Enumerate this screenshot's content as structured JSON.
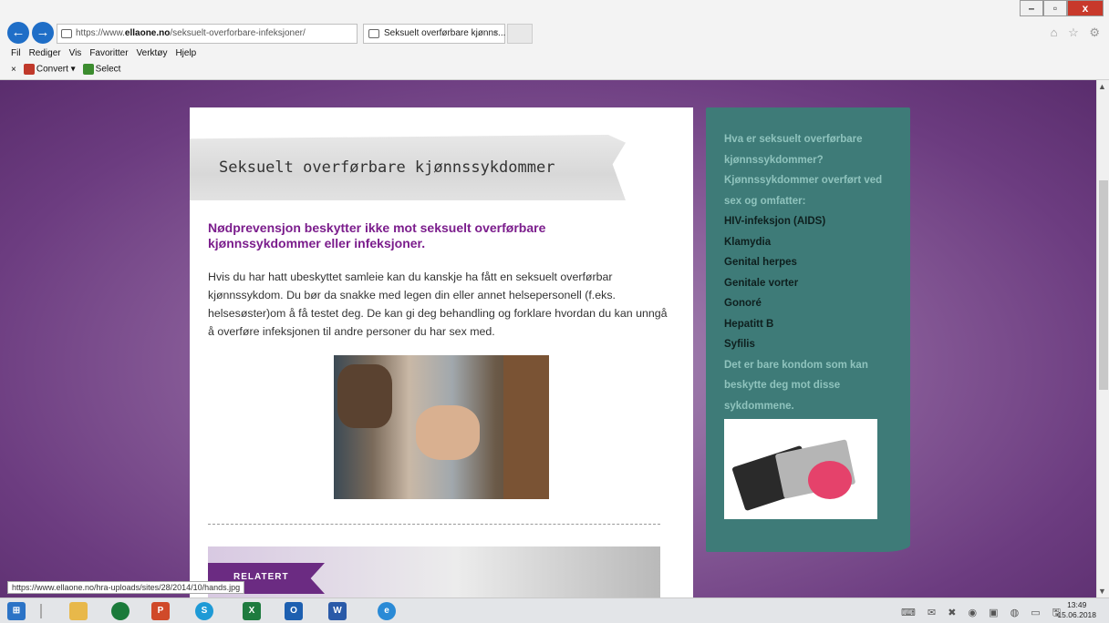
{
  "window": {
    "minimize": "–",
    "restore": "▫",
    "close": "x"
  },
  "browser": {
    "back": "←",
    "forward": "→",
    "address_prefix": "https://www.",
    "address_domain": "ellaone.no",
    "address_path": "/seksuelt-overforbare-infeksjoner/",
    "address_icons": "⌕ ▾ 🔒 ↻",
    "tab_title": "Seksuelt overførbare kjønns...",
    "tab_close": "×",
    "right_icons": "⌂ ☆ ⚙"
  },
  "menu": [
    "Fil",
    "Rediger",
    "Vis",
    "Favoritter",
    "Verktøy",
    "Hjelp"
  ],
  "commandbar": {
    "close": "×",
    "convert": "Convert",
    "convert_arrow": "▾",
    "select": "Select"
  },
  "article": {
    "title": "Seksuelt overførbare kjønnssykdommer",
    "subheading": "Nødprevensjon beskytter ikke mot seksuelt overførbare kjønnssykdommer eller infeksjoner.",
    "paragraph": "Hvis du har hatt ubeskyttet samleie kan du kanskje ha fått en seksuelt overførbar kjønnssykdom. Du bør da snakke med legen din eller annet helsepersonell (f.eks. helsesøster)om å få testet deg. De kan gi deg behandling og forklare hvordan du kan unngå å overføre infeksjonen til andre personer du har sex med.",
    "related_label": "RELATERT"
  },
  "sidebar": {
    "intro": "Hva er seksuelt overførbare kjønnssykdommer? Kjønnssykdommer overført ved sex og omfatter:",
    "diseases": [
      "HIV-infeksjon (AIDS)",
      "Klamydia",
      "Genital herpes",
      "Genitale vorter",
      "Gonoré",
      "Hepatitt B",
      "Syfilis"
    ],
    "outro": "Det er bare kondom som kan beskytte deg mot disse sykdommene."
  },
  "status_url": "https://www.ellaone.no/hra-uploads/sites/28/2014/10/hands.jpg",
  "taskbar": {
    "ppt": "P",
    "skype": "S",
    "excel": "X",
    "outlook": "O",
    "word": "W",
    "ie": "e",
    "tray": "⌨ ✉ ✖ ◉ ▣ ◍ ▭ 🖫",
    "time": "13:49",
    "date": "15.06.2018"
  }
}
